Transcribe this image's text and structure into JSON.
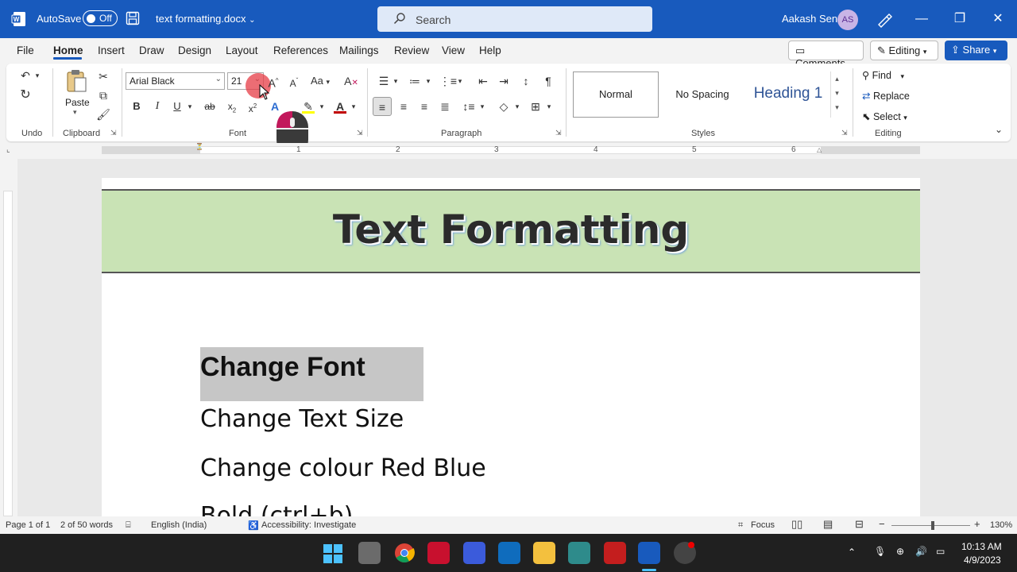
{
  "titlebar": {
    "autosave_label": "AutoSave",
    "autosave_state": "Off",
    "doc_title": "text formatting.docx",
    "search_placeholder": "Search",
    "user_name": "Aakash Sen",
    "user_initials": "AS",
    "minimize": "—",
    "maximize": "❐",
    "close": "✕"
  },
  "menu": {
    "tabs": [
      "File",
      "Home",
      "Insert",
      "Draw",
      "Design",
      "Layout",
      "References",
      "Mailings",
      "Review",
      "View",
      "Help"
    ],
    "comments_label": "Comments",
    "editing_label": "Editing",
    "share_label": "Share"
  },
  "ribbon": {
    "groups": {
      "undo": "Undo",
      "clipboard": "Clipboard",
      "font": "Font",
      "paragraph": "Paragraph",
      "styles": "Styles",
      "editing": "Editing"
    },
    "paste_label": "Paste",
    "font_name": "Arial Black",
    "font_size": "21",
    "case_label": "Aa",
    "bold": "B",
    "italic": "I",
    "underline": "U",
    "strike": "ab",
    "styles": [
      "Normal",
      "No Spacing",
      "Heading 1"
    ],
    "find_label": "Find",
    "replace_label": "Replace",
    "select_label": "Select"
  },
  "ruler": {
    "numbers": [
      "1",
      "2",
      "3",
      "4",
      "5",
      "6"
    ]
  },
  "document": {
    "banner_title": "Text Formatting",
    "lines": [
      "Change Font",
      "Change Text Size",
      "Change colour Red Blue",
      "Bold (ctrl+b)"
    ]
  },
  "status": {
    "page": "Page 1 of 1",
    "words": "2 of 50 words",
    "language": "English (India)",
    "accessibility": "Accessibility: Investigate",
    "focus": "Focus",
    "zoom": "130%"
  },
  "tray": {
    "time": "10:13 AM",
    "date": "4/9/2023"
  },
  "colors": {
    "accent": "#185abd",
    "banner_bg": "#c9e3b5",
    "highlight": "#c6c6c6",
    "font_color_bar": "#c00000",
    "highlight_color_bar": "#ffff00"
  }
}
